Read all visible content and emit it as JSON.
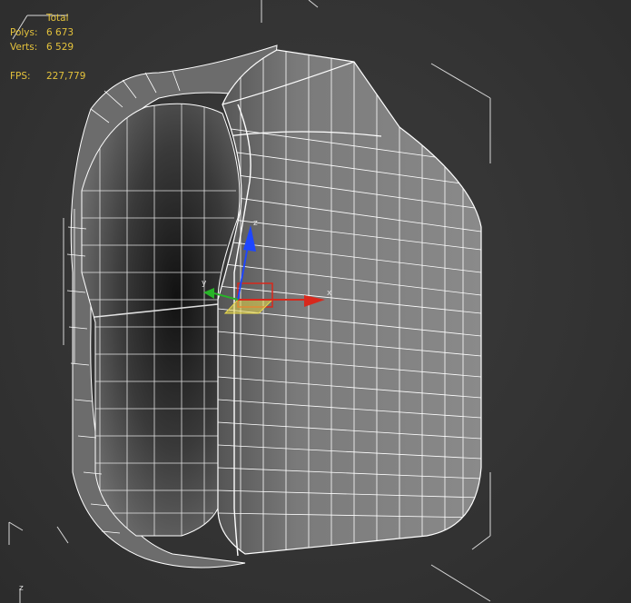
{
  "stats": {
    "header": "Total",
    "polys_label": "Polys:",
    "polys_value": "6 673",
    "verts_label": "Verts:",
    "verts_value": "6 529",
    "fps_label": "FPS:",
    "fps_value": "227,779"
  },
  "gizmo": {
    "x_label": "x",
    "y_label": "y",
    "z_label": "z"
  },
  "viewcube": {
    "axis_label": "z"
  },
  "colors": {
    "background": "#353535",
    "wire": "#ffffff",
    "stats_text": "#e4c23c",
    "gizmo_x": "#d8281c",
    "gizmo_y": "#28b428",
    "gizmo_z": "#1e46ff"
  }
}
